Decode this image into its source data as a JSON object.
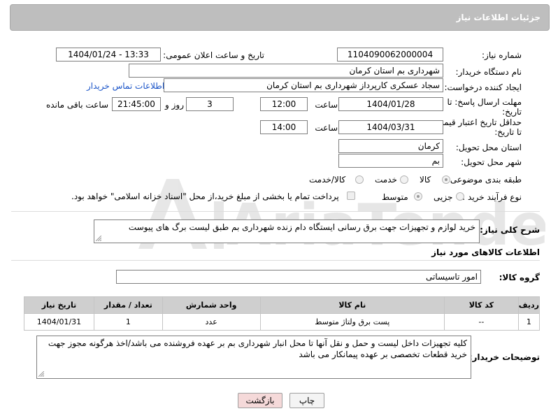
{
  "header": {
    "title": "جزئیات اطلاعات نیاز"
  },
  "form": {
    "need_number": {
      "label": "شماره نیاز:",
      "value": "1104090062000004"
    },
    "announce_datetime": {
      "label": "تاریخ و ساعت اعلان عمومی:",
      "value": "1404/01/24 - 13:33"
    },
    "buyer_org": {
      "label": "نام دستگاه خریدار:",
      "value": "شهرداری بم استان کرمان"
    },
    "requester": {
      "label": "ایجاد کننده درخواست:",
      "value": "سجاد عسکری کارپرداز شهرداری بم استان کرمان",
      "contact_link": "اطلاعات تماس خریدار"
    },
    "reply_deadline": {
      "label_line1": "مهلت ارسال پاسخ: تا",
      "label_line2": "تاریخ:",
      "date": "1404/01/28",
      "time_label": "ساعت",
      "time": "12:00",
      "days": "3",
      "days_label": "روز و",
      "remaining": "21:45:00",
      "remaining_label": "ساعت باقی مانده"
    },
    "price_validity": {
      "label_line1": "حداقل تاریخ اعتبار قیمت:",
      "label_line2": "تا تاریخ:",
      "date": "1404/03/31",
      "time_label": "ساعت",
      "time": "14:00"
    },
    "province": {
      "label": "استان محل تحویل:",
      "value": "کرمان"
    },
    "city": {
      "label": "شهر محل تحویل:",
      "value": "بم"
    },
    "category": {
      "label": "طبقه بندی موضوعی:",
      "options": [
        "کالا",
        "خدمت",
        "کالا/خدمت"
      ],
      "selected": "کالا"
    },
    "process_type": {
      "label": "نوع فرآیند خرید :",
      "options": [
        "جزیی",
        "متوسط"
      ],
      "selected": "متوسط",
      "payment_note": "پرداخت تمام یا بخشی از مبلغ خرید،از محل \"اسناد خزانه اسلامی\" خواهد بود."
    }
  },
  "description": {
    "label": "شرح کلی نیاز:",
    "value": "خرید لوازم و تجهیزات جهت برق رسانی ایستگاه دام زنده شهرداری بم طبق لیست برگ های پیوست"
  },
  "goods_section": {
    "title": "اطلاعات کالاهای مورد نیاز",
    "group_label": "گروه کالا:",
    "group_value": "امور تاسیساتی",
    "table": {
      "headers": [
        "ردیف",
        "کد کالا",
        "نام کالا",
        "واحد شمارش",
        "تعداد / مقدار",
        "تاریخ نیاز"
      ],
      "rows": [
        {
          "row": "1",
          "code": "--",
          "name": "پست برق ولتاژ متوسط",
          "unit": "عدد",
          "qty": "1",
          "date": "1404/01/31"
        }
      ]
    }
  },
  "buyer_notes": {
    "label": "توضیحات خریدار:",
    "value": "کلیه تجهیزات داخل لیست و حمل و نقل آنها تا محل انبار شهرداری بم بر عهده فروشنده  می باشد/اخذ هرگونه مجوز جهت خرید قطعات تخصصی بر عهده پیمانکار می باشد"
  },
  "buttons": {
    "print": "چاپ",
    "back": "بازگشت"
  },
  "watermark_text": "AriaTender.neT",
  "colors": {
    "header_bg": "#bebebe",
    "link": "#1a54c8",
    "back_button_bg": "#f5d9d9",
    "table_header_bg": "#cfcfcf"
  }
}
